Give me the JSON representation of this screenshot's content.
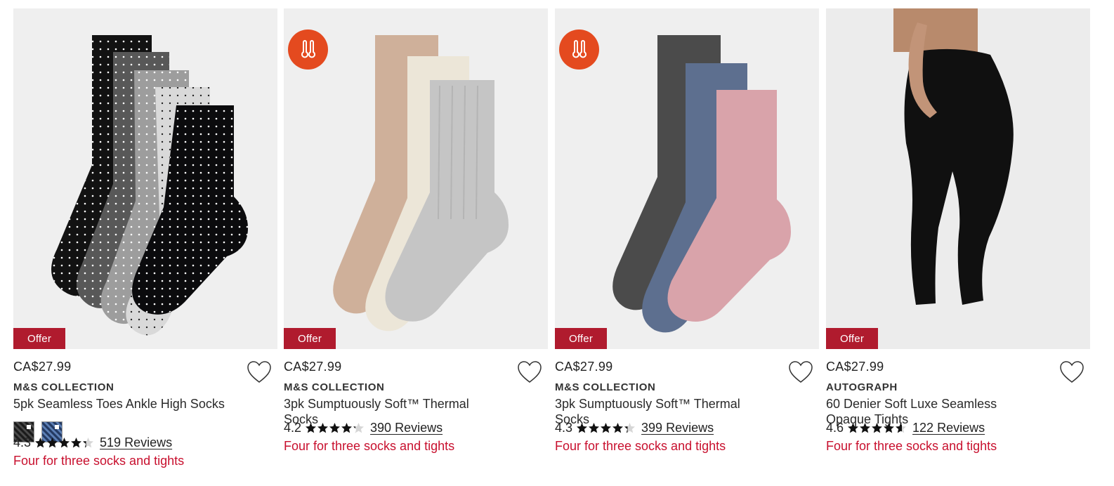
{
  "colors": {
    "offer_bg": "#b01b2e",
    "promo_text": "#c8102e",
    "thermal_badge": "#e44a1f",
    "image_bg": "#efefef"
  },
  "products": [
    {
      "image_icon": "polka-dot-socks-image",
      "thermal": false,
      "offer_label": "Offer",
      "price": "CA$27.99",
      "brand": "M&S COLLECTION",
      "name": "5pk Seamless Toes Ankle High Socks",
      "swatches": [
        "black-pattern",
        "navy-pattern"
      ],
      "rating": "4.3",
      "rating_value": 4.3,
      "reviews": "519 Reviews",
      "promo": "Four for three socks and tights"
    },
    {
      "image_icon": "neutral-thermal-socks-image",
      "thermal": true,
      "offer_label": "Offer",
      "price": "CA$27.99",
      "brand": "M&S COLLECTION",
      "name": "3pk Sumptuously Soft™ Thermal Socks",
      "swatches": [],
      "rating": "4.2",
      "rating_value": 4.2,
      "reviews": "390 Reviews",
      "promo": "Four for three socks and tights"
    },
    {
      "image_icon": "colour-thermal-socks-image",
      "thermal": true,
      "offer_label": "Offer",
      "price": "CA$27.99",
      "brand": "M&S COLLECTION",
      "name": "3pk Sumptuously Soft™ Thermal Socks",
      "swatches": [],
      "rating": "4.3",
      "rating_value": 4.3,
      "reviews": "399 Reviews",
      "promo": "Four for three socks and tights"
    },
    {
      "image_icon": "black-tights-image",
      "thermal": false,
      "offer_label": "Offer",
      "price": "CA$27.99",
      "brand": "AUTOGRAPH",
      "name": "60 Denier Soft Luxe Seamless Opaque Tights",
      "swatches": [],
      "rating": "4.6",
      "rating_value": 4.6,
      "reviews": "122 Reviews",
      "promo": "Four for three socks and tights"
    }
  ]
}
